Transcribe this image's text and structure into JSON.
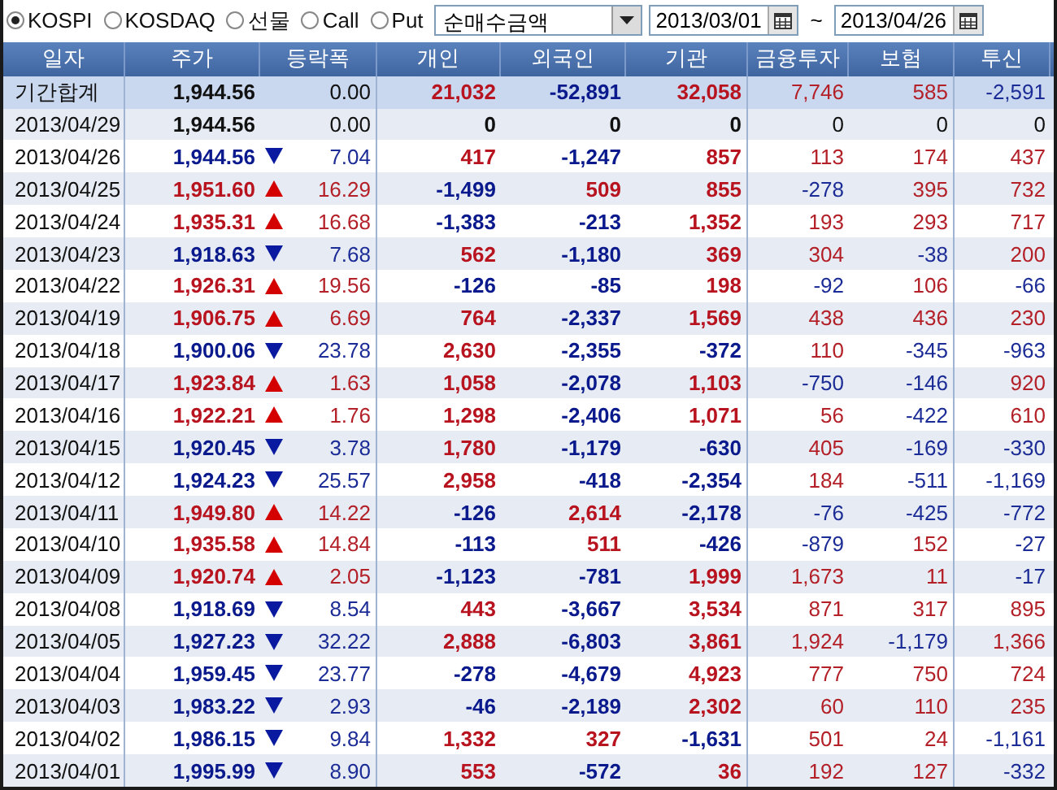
{
  "markets": [
    {
      "label": "KOSPI",
      "selected": true
    },
    {
      "label": "KOSDAQ",
      "selected": false
    },
    {
      "label": "선물",
      "selected": false
    },
    {
      "label": "Call",
      "selected": false
    },
    {
      "label": "Put",
      "selected": false
    }
  ],
  "metric": {
    "value": "순매수금액"
  },
  "date_from": {
    "value": "2013/03/01"
  },
  "range_separator": "~",
  "date_to": {
    "value": "2013/04/26"
  },
  "table": {
    "columns": [
      "일자",
      "주가",
      "등락폭",
      "개인",
      "외국인",
      "기관",
      "금융투자",
      "보험",
      "투신"
    ],
    "rows": [
      {
        "kind": "total",
        "date": "기간합계",
        "price": "1,944.56",
        "rising": false,
        "falling": false,
        "change": "0.00",
        "individual": "21,032",
        "foreign": "-52,891",
        "institution": "32,058",
        "financial": "7,746",
        "insurance": "585",
        "trust": "-2,591"
      },
      {
        "kind": "day",
        "date": "2013/04/29",
        "price": "1,944.56",
        "rising": false,
        "falling": false,
        "change": "0.00",
        "individual": "0",
        "foreign": "0",
        "institution": "0",
        "financial": "0",
        "insurance": "0",
        "trust": "0"
      },
      {
        "kind": "day",
        "date": "2013/04/26",
        "price": "1,944.56",
        "rising": false,
        "falling": true,
        "change": "7.04",
        "individual": "417",
        "foreign": "-1,247",
        "institution": "857",
        "financial": "113",
        "insurance": "174",
        "trust": "437"
      },
      {
        "kind": "day",
        "date": "2013/04/25",
        "price": "1,951.60",
        "rising": true,
        "falling": false,
        "change": "16.29",
        "individual": "-1,499",
        "foreign": "509",
        "institution": "855",
        "financial": "-278",
        "insurance": "395",
        "trust": "732"
      },
      {
        "kind": "day",
        "date": "2013/04/24",
        "price": "1,935.31",
        "rising": true,
        "falling": false,
        "change": "16.68",
        "individual": "-1,383",
        "foreign": "-213",
        "institution": "1,352",
        "financial": "193",
        "insurance": "293",
        "trust": "717"
      },
      {
        "kind": "day",
        "date": "2013/04/23",
        "price": "1,918.63",
        "rising": false,
        "falling": true,
        "change": "7.68",
        "individual": "562",
        "foreign": "-1,180",
        "institution": "369",
        "financial": "304",
        "insurance": "-38",
        "trust": "200"
      },
      {
        "kind": "day",
        "date": "2013/04/22",
        "price": "1,926.31",
        "rising": true,
        "falling": false,
        "change": "19.56",
        "individual": "-126",
        "foreign": "-85",
        "institution": "198",
        "financial": "-92",
        "insurance": "106",
        "trust": "-66"
      },
      {
        "kind": "day",
        "date": "2013/04/19",
        "price": "1,906.75",
        "rising": true,
        "falling": false,
        "change": "6.69",
        "individual": "764",
        "foreign": "-2,337",
        "institution": "1,569",
        "financial": "438",
        "insurance": "436",
        "trust": "230"
      },
      {
        "kind": "day",
        "date": "2013/04/18",
        "price": "1,900.06",
        "rising": false,
        "falling": true,
        "change": "23.78",
        "individual": "2,630",
        "foreign": "-2,355",
        "institution": "-372",
        "financial": "110",
        "insurance": "-345",
        "trust": "-963"
      },
      {
        "kind": "day",
        "date": "2013/04/17",
        "price": "1,923.84",
        "rising": true,
        "falling": false,
        "change": "1.63",
        "individual": "1,058",
        "foreign": "-2,078",
        "institution": "1,103",
        "financial": "-750",
        "insurance": "-146",
        "trust": "920"
      },
      {
        "kind": "day",
        "date": "2013/04/16",
        "price": "1,922.21",
        "rising": true,
        "falling": false,
        "change": "1.76",
        "individual": "1,298",
        "foreign": "-2,406",
        "institution": "1,071",
        "financial": "56",
        "insurance": "-422",
        "trust": "610"
      },
      {
        "kind": "day",
        "date": "2013/04/15",
        "price": "1,920.45",
        "rising": false,
        "falling": true,
        "change": "3.78",
        "individual": "1,780",
        "foreign": "-1,179",
        "institution": "-630",
        "financial": "405",
        "insurance": "-169",
        "trust": "-330"
      },
      {
        "kind": "day",
        "date": "2013/04/12",
        "price": "1,924.23",
        "rising": false,
        "falling": true,
        "change": "25.57",
        "individual": "2,958",
        "foreign": "-418",
        "institution": "-2,354",
        "financial": "184",
        "insurance": "-511",
        "trust": "-1,169"
      },
      {
        "kind": "day",
        "date": "2013/04/11",
        "price": "1,949.80",
        "rising": true,
        "falling": false,
        "change": "14.22",
        "individual": "-126",
        "foreign": "2,614",
        "institution": "-2,178",
        "financial": "-76",
        "insurance": "-425",
        "trust": "-772"
      },
      {
        "kind": "day",
        "date": "2013/04/10",
        "price": "1,935.58",
        "rising": true,
        "falling": false,
        "change": "14.84",
        "individual": "-113",
        "foreign": "511",
        "institution": "-426",
        "financial": "-879",
        "insurance": "152",
        "trust": "-27"
      },
      {
        "kind": "day",
        "date": "2013/04/09",
        "price": "1,920.74",
        "rising": true,
        "falling": false,
        "change": "2.05",
        "individual": "-1,123",
        "foreign": "-781",
        "institution": "1,999",
        "financial": "1,673",
        "insurance": "11",
        "trust": "-17"
      },
      {
        "kind": "day",
        "date": "2013/04/08",
        "price": "1,918.69",
        "rising": false,
        "falling": true,
        "change": "8.54",
        "individual": "443",
        "foreign": "-3,667",
        "institution": "3,534",
        "financial": "871",
        "insurance": "317",
        "trust": "895"
      },
      {
        "kind": "day",
        "date": "2013/04/05",
        "price": "1,927.23",
        "rising": false,
        "falling": true,
        "change": "32.22",
        "individual": "2,888",
        "foreign": "-6,803",
        "institution": "3,861",
        "financial": "1,924",
        "insurance": "-1,179",
        "trust": "1,366"
      },
      {
        "kind": "day",
        "date": "2013/04/04",
        "price": "1,959.45",
        "rising": false,
        "falling": true,
        "change": "23.77",
        "individual": "-278",
        "foreign": "-4,679",
        "institution": "4,923",
        "financial": "777",
        "insurance": "750",
        "trust": "724"
      },
      {
        "kind": "day",
        "date": "2013/04/03",
        "price": "1,983.22",
        "rising": false,
        "falling": true,
        "change": "2.93",
        "individual": "-46",
        "foreign": "-2,189",
        "institution": "2,302",
        "financial": "60",
        "insurance": "110",
        "trust": "235"
      },
      {
        "kind": "day",
        "date": "2013/04/02",
        "price": "1,986.15",
        "rising": false,
        "falling": true,
        "change": "9.84",
        "individual": "1,332",
        "foreign": "327",
        "institution": "-1,631",
        "financial": "501",
        "insurance": "24",
        "trust": "-1,161"
      },
      {
        "kind": "day",
        "date": "2013/04/01",
        "price": "1,995.99",
        "rising": false,
        "falling": true,
        "change": "8.90",
        "individual": "553",
        "foreign": "-572",
        "institution": "36",
        "financial": "192",
        "insurance": "127",
        "trust": "-332"
      }
    ]
  }
}
